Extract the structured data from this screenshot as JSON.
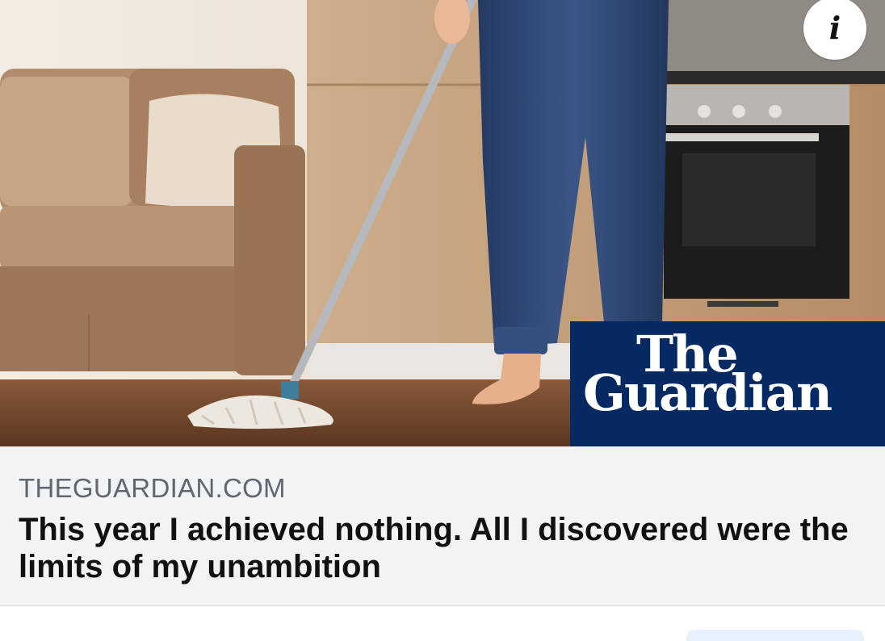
{
  "post": {
    "image": {
      "alt_icon": "info-icon",
      "brand_line1": "The",
      "brand_line2": "Guardian",
      "brand_color": "#052962"
    },
    "info_button_glyph": "i",
    "link": {
      "domain": "THEGUARDIAN.COM",
      "headline": "This year I achieved nothing. All I discovered were the limits of my unambition"
    }
  },
  "colors": {
    "meta_background": "#f2f3f5",
    "domain_text": "#606770",
    "headline_text": "#111111"
  }
}
